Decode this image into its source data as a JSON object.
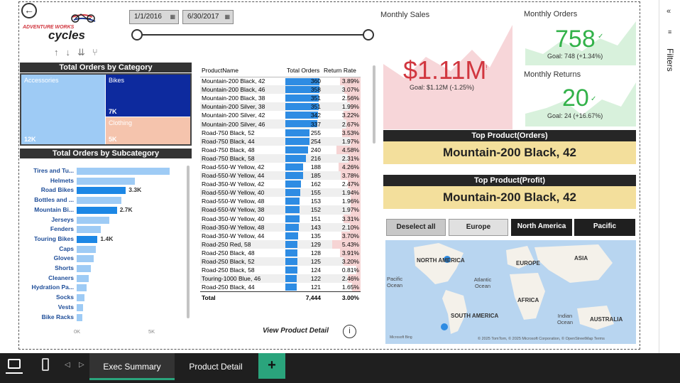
{
  "filters": {
    "start_date": "1/1/2016",
    "end_date": "6/30/2017"
  },
  "logo": {
    "line1": "ADVENTURE WORKS",
    "line2": "cycles"
  },
  "treemap": {
    "title": "Total Orders by Category",
    "cells": [
      {
        "name": "Accessories",
        "value": "12K",
        "color": "#9ecbf5"
      },
      {
        "name": "Bikes",
        "value": "7K",
        "color": "#0d2a9e"
      },
      {
        "name": "Clothing",
        "value": "5K",
        "color": "#f5c4ad"
      }
    ]
  },
  "subcategory_chart": {
    "title": "Total Orders by Subcategory",
    "axis_ticks": [
      "0K",
      "5K"
    ],
    "xlim": [
      0,
      6000
    ],
    "bars": [
      {
        "name": "Tires and Tu...",
        "value": 6250,
        "label": "",
        "highlight": false
      },
      {
        "name": "Helmets",
        "value": 3900,
        "label": "",
        "highlight": false
      },
      {
        "name": "Road Bikes",
        "value": 3300,
        "label": "3.3K",
        "highlight": true
      },
      {
        "name": "Bottles and ...",
        "value": 3000,
        "label": "",
        "highlight": false
      },
      {
        "name": "Mountain Bi...",
        "value": 2700,
        "label": "2.7K",
        "highlight": true
      },
      {
        "name": "Jerseys",
        "value": 2200,
        "label": "",
        "highlight": false
      },
      {
        "name": "Fenders",
        "value": 1600,
        "label": "",
        "highlight": false
      },
      {
        "name": "Touring Bikes",
        "value": 1400,
        "label": "1.4K",
        "highlight": true
      },
      {
        "name": "Caps",
        "value": 1300,
        "label": "",
        "highlight": false
      },
      {
        "name": "Gloves",
        "value": 1150,
        "label": "",
        "highlight": false
      },
      {
        "name": "Shorts",
        "value": 950,
        "label": "",
        "highlight": false
      },
      {
        "name": "Cleaners",
        "value": 800,
        "label": "",
        "highlight": false
      },
      {
        "name": "Hydration Pa...",
        "value": 650,
        "label": "",
        "highlight": false
      },
      {
        "name": "Socks",
        "value": 500,
        "label": "",
        "highlight": false
      },
      {
        "name": "Vests",
        "value": 450,
        "label": "",
        "highlight": false
      },
      {
        "name": "Bike Racks",
        "value": 400,
        "label": "",
        "highlight": false
      }
    ]
  },
  "product_table": {
    "headers": [
      "ProductName",
      "Total Orders",
      "Return Rate"
    ],
    "max_orders": 360,
    "rows": [
      [
        "Mountain-200 Black, 42",
        360,
        "3.89%"
      ],
      [
        "Mountain-200 Black, 46",
        358,
        "3.07%"
      ],
      [
        "Mountain-200 Black, 38",
        351,
        "2.56%"
      ],
      [
        "Mountain-200 Silver, 38",
        351,
        "1.99%"
      ],
      [
        "Mountain-200 Silver, 42",
        342,
        "3.22%"
      ],
      [
        "Mountain-200 Silver, 46",
        337,
        "2.67%"
      ],
      [
        "Road-750 Black, 52",
        255,
        "3.53%"
      ],
      [
        "Road-750 Black, 44",
        254,
        "1.97%"
      ],
      [
        "Road-750 Black, 48",
        240,
        "4.58%"
      ],
      [
        "Road-750 Black, 58",
        216,
        "2.31%"
      ],
      [
        "Road-550-W Yellow, 42",
        188,
        "4.26%"
      ],
      [
        "Road-550-W Yellow, 44",
        185,
        "3.78%"
      ],
      [
        "Road-350-W Yellow, 42",
        162,
        "2.47%"
      ],
      [
        "Road-550-W Yellow, 40",
        155,
        "1.94%"
      ],
      [
        "Road-550-W Yellow, 48",
        153,
        "1.96%"
      ],
      [
        "Road-550-W Yellow, 38",
        152,
        "1.97%"
      ],
      [
        "Road-350-W Yellow, 40",
        151,
        "3.31%"
      ],
      [
        "Road-350-W Yellow, 48",
        143,
        "2.10%"
      ],
      [
        "Road-350-W Yellow, 44",
        135,
        "3.70%"
      ],
      [
        "Road-250 Red, 58",
        129,
        "5.43%"
      ],
      [
        "Road-250 Black, 48",
        128,
        "3.91%"
      ],
      [
        "Road-250 Black, 52",
        125,
        "3.20%"
      ],
      [
        "Road-250 Black, 58",
        124,
        "0.81%"
      ],
      [
        "Touring-1000 Blue, 46",
        122,
        "2.46%"
      ],
      [
        "Road-250 Black, 44",
        121,
        "1.65%"
      ]
    ],
    "total": [
      "Total",
      "7,444",
      "3.00%"
    ]
  },
  "view_detail": "View Product Detail",
  "kpi": {
    "sales": {
      "title": "Monthly Sales",
      "value": "$1.11M",
      "goal": "Goal: $1.12M (-1.25%)"
    },
    "orders": {
      "title": "Monthly Orders",
      "value": "758",
      "goal": "Goal: 748 (+1.34%)"
    },
    "returns": {
      "title": "Monthly Returns",
      "value": "20",
      "goal": "Goal: 24 (+16.67%)"
    }
  },
  "top_orders": {
    "title": "Top Product(Orders)",
    "value": "Mountain-200 Black, 42"
  },
  "top_profit": {
    "title": "Top Product(Profit)",
    "value": "Mountain-200 Black, 42"
  },
  "region_slicer": [
    "Deselect all",
    "Europe",
    "North America",
    "Pacific"
  ],
  "map": {
    "labels": [
      "NORTH AMERICA",
      "EUROPE",
      "ASIA",
      "Pacific Ocean",
      "Atlantic Ocean",
      "AFRICA",
      "SOUTH AMERICA",
      "Indian Ocean",
      "AUSTRALIA"
    ],
    "attribution": "© 2025 TomTom, © 2025 Microsoft Corporation, © OpenStreetMap  Terms",
    "brand": "Microsoft Bing"
  },
  "filters_pane": {
    "label": "Filters"
  },
  "tabs": [
    "Exec Summary",
    "Product Detail"
  ],
  "colors": {
    "accent_green": "#33b24a",
    "accent_red": "#d1363f",
    "bar_blue": "#1c87e5",
    "bar_light": "#9ecbf5"
  }
}
